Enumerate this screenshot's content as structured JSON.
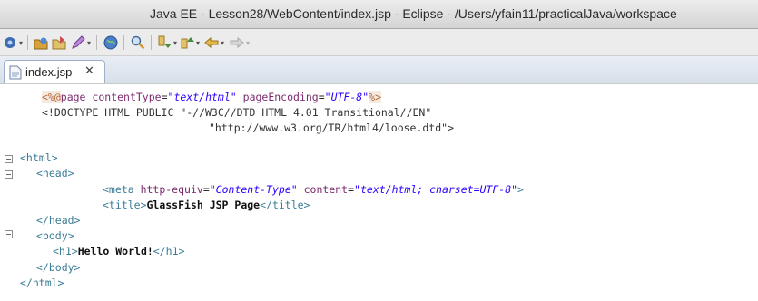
{
  "window": {
    "title": "Java EE - Lesson28/WebContent/index.jsp - Eclipse - /Users/yfain11/practicalJava/workspace"
  },
  "toolbar": {
    "buttons": [
      {
        "name": "new-wizard",
        "icon": "new-icon"
      },
      {
        "name": "open-type",
        "icon": "open-type-icon"
      },
      {
        "name": "new-java-class",
        "icon": "new-class-icon"
      },
      {
        "name": "new-jsp",
        "icon": "pen-icon"
      },
      {
        "name": "open-web-browser",
        "icon": "globe-icon"
      },
      {
        "name": "search",
        "icon": "search-icon"
      },
      {
        "name": "next-annotation",
        "icon": "next-annotation-icon"
      },
      {
        "name": "previous-annotation",
        "icon": "previous-annotation-icon"
      },
      {
        "name": "back",
        "icon": "back-icon"
      },
      {
        "name": "forward",
        "icon": "forward-icon"
      }
    ]
  },
  "editor": {
    "tab": {
      "label": "index.jsp",
      "close_icon": "close-icon"
    },
    "lines": {
      "l1_open": "<%@",
      "l1_page": "page",
      "l1_attr1": "contentType",
      "l1_val1": "\"text/html\"",
      "l1_attr2": "pageEncoding",
      "l1_val2": "\"UTF-8\"",
      "l1_close": "%>",
      "l2": "<!DOCTYPE HTML PUBLIC \"-//W3C//DTD HTML 4.01 Transitional//EN\"",
      "l3": "\"http://www.w3.org/TR/html4/loose.dtd\">",
      "l5": "<html>",
      "l6": "<head>",
      "l7_open": "<meta",
      "l7_attr1": "http-equiv",
      "l7_val1": "\"Content-Type\"",
      "l7_attr2": "content",
      "l7_val2": "\"text/html; charset=UTF-8\"",
      "l7_close": ">",
      "l8_open": "<title>",
      "l8_text": "GlassFish JSP Page",
      "l8_close": "</title>",
      "l9": "</head>",
      "l10": "<body>",
      "l11_open": "<h1>",
      "l11_text": "Hello World!",
      "l11_close": "</h1>",
      "l12": "</body>",
      "l13": "</html>"
    }
  }
}
